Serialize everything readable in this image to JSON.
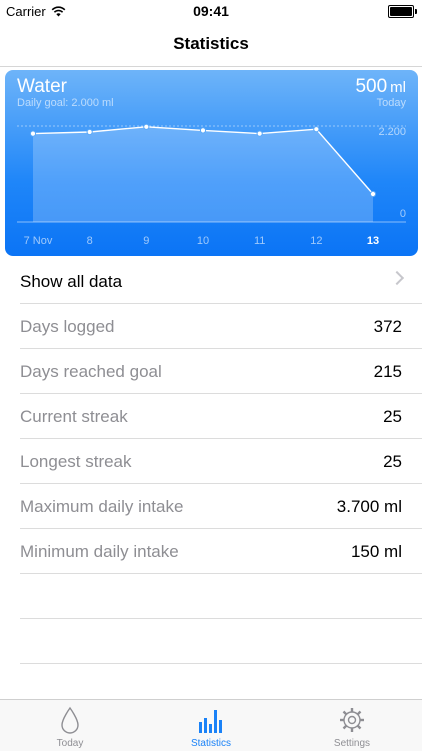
{
  "status": {
    "carrier": "Carrier",
    "time": "09:41"
  },
  "nav": {
    "title": "Statistics"
  },
  "card": {
    "title": "Water",
    "goal_text": "Daily goal: 2.000 ml",
    "value": "500",
    "unit": "ml",
    "period": "Today",
    "ref_label": "2.200",
    "zero_label": "0"
  },
  "chart_data": {
    "type": "line",
    "x": [
      "7 Nov",
      "8",
      "9",
      "10",
      "11",
      "12",
      "13"
    ],
    "values": [
      2010,
      2050,
      2180,
      2090,
      2010,
      2120,
      500
    ],
    "ylim": [
      0,
      3100
    ],
    "reference_line": 2200,
    "goal": 2000,
    "highlight_index": 6
  },
  "list": [
    {
      "label": "Show all data",
      "value": ""
    },
    {
      "label": "Days logged",
      "value": "372"
    },
    {
      "label": "Days reached goal",
      "value": "215"
    },
    {
      "label": "Current streak",
      "value": "25"
    },
    {
      "label": "Longest streak",
      "value": "25"
    },
    {
      "label": "Maximum daily intake",
      "value": "3.700 ml"
    },
    {
      "label": "Minimum daily intake",
      "value": "150 ml"
    }
  ],
  "tabs": [
    {
      "label": "Today",
      "icon": "drop-icon"
    },
    {
      "label": "Statistics",
      "icon": "bar-chart-icon"
    },
    {
      "label": "Settings",
      "icon": "gear-icon"
    }
  ],
  "colors": {
    "accent": "#1a82f7",
    "card_top": "#6eb4f9",
    "card_bottom": "#0b74f5"
  }
}
